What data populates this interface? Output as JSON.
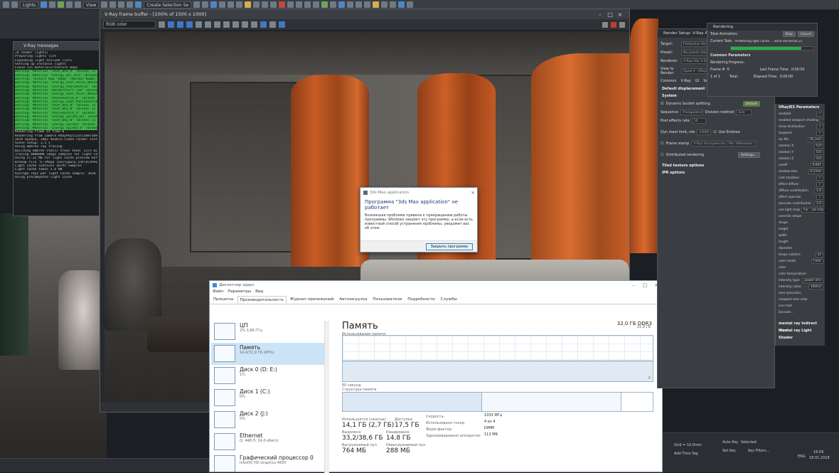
{
  "max_toolbar": {
    "layer_dropdown": "Lights",
    "view_dropdown": "View",
    "selection_set": "Create Selection Se"
  },
  "vray_messages": {
    "title": "V-Ray messages",
    "lines": [
      {
        "text": "[0 render lights]",
        "type": "info"
      },
      {
        "text": "Preparing lights list",
        "type": "info"
      },
      {
        "text": "Expanding light exclude lists",
        "type": "info"
      },
      {
        "text": "Setting up instance lights",
        "type": "info"
      },
      {
        "text": "Found 225 materials/texture maps",
        "type": "info"
      },
      {
        "text": "warning: Material \"Seat_Bka_V\" (Blend) is not co",
        "type": "warn"
      },
      {
        "text": "warning: Material \"Energy_Vel_B/V\" (Blend) is not",
        "type": "warn"
      },
      {
        "text": "warning: Texture map \"Bump\" (Normal Bump) is",
        "type": "warn"
      },
      {
        "text": "warning: Material \"Energy_Seat_Pelel_Nanuth\" (",
        "type": "warn"
      },
      {
        "text": "warning: Material \"Energy_Podlokotnik\" (Blend)",
        "type": "warn"
      },
      {
        "text": "warning: Material \"RenderStuff.com\" (Blend) is n",
        "type": "warn"
      },
      {
        "text": "warning: Material \"Energy_Seat_Pelel_Nanuth\" (",
        "type": "warn"
      },
      {
        "text": "warning: Material \"Podlokotnik_V\" (Blend) is not",
        "type": "warn"
      },
      {
        "text": "warning: Material \"Energy_Seat_Podlokotnik\"",
        "type": "warn"
      },
      {
        "text": "warning: Material \"Seat_Bka_N\" (Blend) is not",
        "type": "warn"
      },
      {
        "text": "warning: Material \"Seat_Bka_N\" (Blend) is not c",
        "type": "warn"
      },
      {
        "text": "warning: Material \"Podlokotnik_V\" (Blend) is no",
        "type": "warn"
      },
      {
        "text": "warning: Material \"Energy_Spinka_D2\" (Blend)",
        "type": "warn"
      },
      {
        "text": "warning: Material \"Seat_Bka_N\" (Blend) is not c",
        "type": "warn"
      },
      {
        "text": "warning: Material \"Energy_Spinka\" (Blend) is n",
        "type": "warn"
      },
      {
        "text": "warning: Material \"Energy_Spinka_V\" (Blend)",
        "type": "warn"
      },
      {
        "text": "Rendering frame at time 0",
        "type": "info"
      },
      {
        "text": "Rendering from camera VRayPhysicalCamera09",
        "type": "info"
      },
      {
        "text": "1070 opaque, 1062 double-sided render instance",
        "type": "info"
      },
      {
        "text": "Scene setup: 1.5 s",
        "type": "info"
      },
      {
        "text": "Using embree ray tracing",
        "type": "info"
      },
      {
        "text": "Building embree static trees took: 2175 millisecon",
        "type": "info"
      },
      {
        "text": "Tracing 4000000 image samples for light cache ir",
        "type": "info"
      },
      {
        "text": "Using 57.22 MB for light cache preview buffer",
        "type": "info"
      },
      {
        "text": "Bitmap file \"E:\\Мари Текстуры\\Б_Ink\\VizPeopl",
        "type": "info"
      },
      {
        "text": "Light cache contains 16795 samples",
        "type": "info"
      },
      {
        "text": "Light cache takes 5.6 MB",
        "type": "info"
      },
      {
        "text": "Average rays per light cache sample: 2818.43 mi",
        "type": "info"
      },
      {
        "text": "Using precomputed light cache",
        "type": "info"
      }
    ]
  },
  "frame_buffer": {
    "title": "V-Ray frame buffer - [100% of 1500 x 1000]",
    "channel": "RGB color"
  },
  "error_dialog": {
    "app_title": "3ds Max application",
    "heading": "Программа \"3ds Max application\" не работает",
    "body": "Возникшая проблема привела к прекращению работы программы. Windows закроет эту программу, а если есть известный способ устранения проблемы, уведомит вас об этом.",
    "button": "Закрыть программу"
  },
  "task_manager": {
    "title": "Диспетчер задач",
    "menu": [
      "Файл",
      "Параметры",
      "Вид"
    ],
    "tabs": [
      "Процессы",
      "Производительность",
      "Журнал приложений",
      "Автозагрузка",
      "Пользователи",
      "Подробности",
      "Службы"
    ],
    "active_tab": "Производительность",
    "sidebar": [
      {
        "name": "ЦП",
        "detail": "2%  3,86 ГГц",
        "selected": false
      },
      {
        "name": "Память",
        "detail": "14,4/31,9 ГБ (45%)",
        "selected": true
      },
      {
        "name": "Диск 0 (D: E:)",
        "detail": "1%",
        "selected": false
      },
      {
        "name": "Диск 1 (C:)",
        "detail": "0%",
        "selected": false
      },
      {
        "name": "Диск 2 (J:)",
        "detail": "0%",
        "selected": false
      },
      {
        "name": "Ethernet",
        "detail": "О: 448  П: 24,0 кбит/с",
        "selected": false
      },
      {
        "name": "Графический процессор 0",
        "detail": "Intel(R) HD Graphics 4600",
        "selected": false
      }
    ],
    "memory": {
      "heading": "Память",
      "total": "32,0 ГБ DDR3",
      "usage_label": "Использование памяти",
      "graph_max": "31,9 ГБ",
      "graph_min": "0",
      "time_label": "60 секунд",
      "usage_fraction": 0.45,
      "structure_label": "Структура памяти",
      "stats": {
        "in_use_label": "Используется (сжатых)",
        "in_use_value": "14,1 ГБ (2,7 ГБ)",
        "available_label": "Доступно",
        "available_value": "17,5 ГБ",
        "committed_label": "Выделено",
        "committed_value": "33,2/38,6 ГБ",
        "cached_label": "Кэшировано",
        "cached_value": "14,8 ГБ",
        "paged_label": "Выгружаемый пул",
        "paged_value": "764 МБ",
        "nonpaged_label": "Невыгружаемый пул",
        "nonpaged_value": "288 МБ"
      },
      "details": [
        {
          "label": "Скорость:",
          "value": "1333 МГц"
        },
        {
          "label": "Использовано гнезд:",
          "value": "4 из 4"
        },
        {
          "label": "Форм-фактор:",
          "value": "DIMM"
        },
        {
          "label": "Зарезервировано аппаратно:",
          "value": "112 МБ"
        }
      ]
    }
  },
  "render_setup": {
    "title": "Render Setup: V-Ray Adv",
    "target_label": "Target:",
    "target_value": "Production Rende",
    "preset_label": "Preset:",
    "preset_value": "No preset selecte",
    "renderer_label": "Renderer:",
    "renderer_value": "V-Ray Adv 3.50.0",
    "view_label": "View to Render:",
    "view_value": "Quad 4 - VRayPh",
    "tabs": [
      "Common",
      "V-Ray",
      "GI",
      "Set"
    ],
    "section_displacement": "Default displacement",
    "section_system": "System",
    "dynamic_bucket": "Dynamic bucket splitting",
    "default_btn": "Default",
    "sequence_label": "Sequence",
    "sequence_value": "Triangulation",
    "division_label": "Division method",
    "division_value": "Size",
    "post_rate_label": "Post effects rate",
    "post_rate_value": "10",
    "dyn_mem_label": "Dyn mem limit, mb",
    "dyn_mem_value": "14000",
    "use_embree": "Use Embree",
    "frame_stamp": "Frame stamp",
    "frame_stamp_value": "V-Ray %vrayversion | file: %filename | fram",
    "distributed": "Distributed rendering",
    "settings_btn": "Settings...",
    "section_tiled": "Tiled texture options",
    "section_ipr": "IPR options"
  },
  "rendering": {
    "title": "Rendering",
    "total_label": "Total Animation:",
    "stop": "Stop",
    "cancel": "Cancel",
    "task_label": "Current Task:",
    "task_value": "Prefiltering light cache ... done [00:00:00.2]",
    "progress": 0.85,
    "common_params": "Common Parameters",
    "progress_label": "Rendering Progress:",
    "frame_label": "Frame #",
    "frame_value": "0",
    "of_label": "1 of 1",
    "total_word": "Total",
    "last_frame_label": "Last Frame Time:",
    "last_frame_value": "0:00:00",
    "elapsed_label": "Elapsed Time:",
    "elapsed_value": "0:00:00"
  },
  "vrayies": {
    "title": "VRayIES Parameters",
    "params": [
      {
        "label": "enabled",
        "value": "✓"
      },
      {
        "label": "enabled viewport shading",
        "value": "✓"
      },
      {
        "label": "show distribution",
        "value": "✓"
      },
      {
        "label": "targeted",
        "value": "✓"
      },
      {
        "label": "ies file",
        "value": "16_ies2"
      },
      {
        "label": "rotation X",
        "value": "0,0"
      },
      {
        "label": "rotation Y",
        "value": "0,0"
      },
      {
        "label": "rotation Z",
        "value": "0,0"
      },
      {
        "label": "cutoff",
        "value": "0,001"
      },
      {
        "label": "shadow bias",
        "value": "0,2mm"
      },
      {
        "label": "cast shadows",
        "value": "✓"
      },
      {
        "label": "affect diffuse",
        "value": "✓"
      },
      {
        "label": "diffuse contribution",
        "value": "1,0"
      },
      {
        "label": "affect specular",
        "value": "✓"
      },
      {
        "label": "specular contribution",
        "value": "1,0"
      },
      {
        "label": "use light shap",
        "value": "For ...ws only"
      },
      {
        "label": "override shape",
        "value": ""
      },
      {
        "label": "shape",
        "value": ""
      },
      {
        "label": "height",
        "value": ""
      },
      {
        "label": "width",
        "value": ""
      },
      {
        "label": "length",
        "value": ""
      },
      {
        "label": "diameter",
        "value": ""
      },
      {
        "label": "shape subdivs",
        "value": "32"
      },
      {
        "label": "color mode",
        "value": "Color"
      },
      {
        "label": "color",
        "value": ""
      },
      {
        "label": "color temperature",
        "value": ""
      },
      {
        "label": "intensity type",
        "value": "power (lm)"
      },
      {
        "label": "intensity value",
        "value": "1000,0"
      },
      {
        "label": "area speculars",
        "value": ""
      },
      {
        "label": "viewport wire color",
        "value": ""
      },
      {
        "label": "icon text",
        "value": ""
      },
      {
        "label": "Exclude...",
        "value": ""
      }
    ],
    "section_indirect": "mental ray Indirect Illum",
    "section_shader": "mental ray Light Shader"
  },
  "status_bar": {
    "grid": "Grid = 10,0mm",
    "add_time_tag": "Add Time Tag",
    "auto_key": "Auto Key",
    "set_key": "Set Key",
    "selected": "Selected",
    "key_filters": "Key Filters...",
    "lang": "ENG",
    "time": "16:09",
    "date": "18.01.2018"
  }
}
